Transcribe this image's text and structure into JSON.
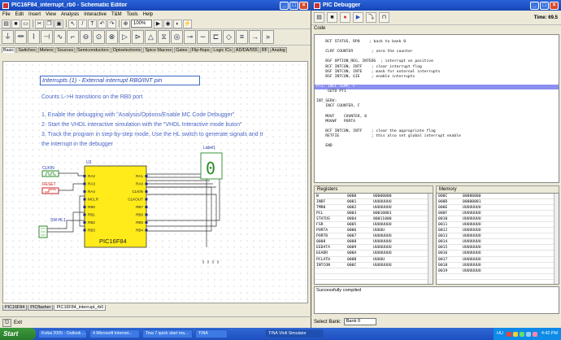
{
  "editor": {
    "title": "PIC16F84_interrupt_rb0 - Schematic Editor",
    "menu": [
      "File",
      "Edit",
      "Insert",
      "View",
      "Analysis",
      "Interactive",
      "T&M",
      "Tools",
      "Help"
    ],
    "zoom": "100%",
    "component_tabs": [
      "Basic",
      "Switches",
      "Meters",
      "Sources",
      "Semiconductors",
      "Optoelectronic",
      "Spice Macros",
      "Gates",
      "Flip-flops",
      "Logic ICs",
      "AD/DA/555",
      "RF",
      "Analog"
    ],
    "document_tabs": [
      "PIC16F84",
      "PICflasher",
      "PIC16F84_interrupt_rb0"
    ],
    "status_exit": "Exit",
    "schematic": {
      "title": "Interrupts (1)  - External interrupt RB0/INT pin",
      "subtitle": "Counts L->H transitions on the RB0 port",
      "steps": [
        "1. Enable the debugging with \"Analysis/Options/Enable MC Code Debugger\"",
        "2. Start the VHDL interactive simulation with the \"VHDL Interactive mode buton\"",
        "3. Track the program in step-by-step mode. Use the HL switch to generate signals and tr",
        "the interrupt in the debugger"
      ],
      "clkin_label": "CLKIN",
      "reset_label": "RESET",
      "switch_label": "SW-HL1",
      "chip_ref": "U2",
      "chip_name": "PIC16F84",
      "left_pins": [
        "RA2",
        "RA3",
        "RA4",
        "MCLR",
        "RB0",
        "RB1",
        "RB2",
        "RB3"
      ],
      "right_pins": [
        "RA1",
        "RA0",
        "CLKIN",
        "CLKOUT",
        "RB7",
        "RB6",
        "RB5",
        "RB4"
      ],
      "display_label": "Label1",
      "display_digit": "0"
    }
  },
  "debugger": {
    "title": "PIC Debugger",
    "time_label": "Time: 69.5",
    "code_label": "Code",
    "code_lines": [
      "",
      "    BCF STATUS, RP0    ; back to bank 0",
      "",
      "    CLRF COUNTER        ; zero the counter",
      "",
      "    BSF OPTION_REG, INTEDG  ; interrupt on positive",
      "    BCF INTCON, INTF    ; clear interrupt flag",
      "    BSF INTCON, INTE    ; mask for external interrupts",
      "    BSF INTCON, GIE     ; enable interrupts",
      "",
      "PT1: INCF TEMP, F",
      "     GOTO PT1",
      "",
      "INT_SERV:",
      "    INCF COUNTER, F",
      "",
      "    MOVF    COUNTER, 0",
      "    MOVWF   PORTA",
      "",
      "    BCF INTCON, INTF    ; clear the appropriate flag",
      "    RETFIE              ; this also set global interrupt enable",
      "",
      "    END",
      "",
      "",
      "",
      ""
    ],
    "highlight_line": 10,
    "registers_label": "Registers",
    "registers": [
      [
        "W",
        "0000",
        "00000000"
      ],
      [
        "INDF",
        "0001",
        "UUUUUUUU"
      ],
      [
        "TMR0",
        "0002",
        "UUUUUUUU"
      ],
      [
        "PCL",
        "0003",
        "00010001"
      ],
      [
        "STATUS",
        "0004",
        "00011000"
      ],
      [
        "FSR",
        "0005",
        "UUUUUUUU"
      ],
      [
        "PORTA",
        "0006",
        "UUUUU"
      ],
      [
        "PORTB",
        "0007",
        "UUUUUUUU"
      ],
      [
        "0008",
        "0008",
        "UUUUUUUU"
      ],
      [
        "EEDATA",
        "0009",
        "UUUUUUUU"
      ],
      [
        "EEADR",
        "000A",
        "UUUUUUUU"
      ],
      [
        "PCLATH",
        "000B",
        "UUUUU"
      ],
      [
        "INTCON",
        "000C",
        "UUUUUUUU"
      ],
      [
        "",
        "",
        ""
      ],
      [
        "",
        "",
        ""
      ],
      [
        "",
        "",
        ""
      ]
    ],
    "memory_label": "Memory",
    "memory": [
      [
        "000C",
        "00000000"
      ],
      [
        "000D",
        "00000001"
      ],
      [
        "000E",
        "UUUUUUUU"
      ],
      [
        "000F",
        "UUUUUUUU"
      ],
      [
        "0010",
        "UUUUUUUU"
      ],
      [
        "0011",
        "UUUUUUUU"
      ],
      [
        "0012",
        "UUUUUUUU"
      ],
      [
        "0013",
        "UUUUUUUU"
      ],
      [
        "0014",
        "UUUUUUUU"
      ],
      [
        "0015",
        "UUUUUUUU"
      ],
      [
        "0016",
        "UUUUUUUU"
      ],
      [
        "0017",
        "UUUUUUUU"
      ],
      [
        "0018",
        "UUUUUUUU"
      ],
      [
        "0019",
        "UUUUUUUU"
      ],
      [
        "",
        ""
      ],
      [
        "",
        ""
      ]
    ],
    "output_text": "Successfully compiled",
    "select_bank_label": "Select Bank:",
    "select_bank_value": "Bank 0"
  },
  "taskbar": {
    "start_label": "Start",
    "tasks": [
      "Koltai 2005 - Outlook ...",
      "4 Microsoft Internet...",
      "Tina 7 quick start ma...",
      "TINA",
      "TINA Vhdl Simulator"
    ],
    "active_task": 4,
    "tray_lang": "HU",
    "clock": "4:42 PM"
  }
}
